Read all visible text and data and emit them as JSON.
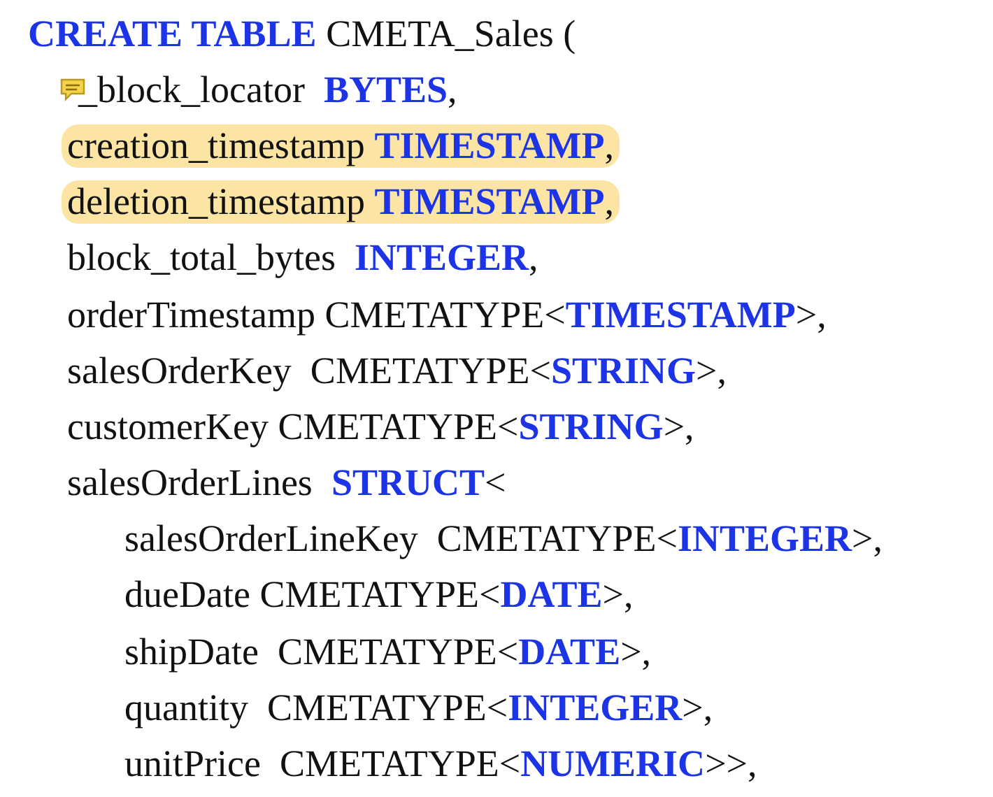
{
  "lines": [
    {
      "text": "**CREATE TABLE** CMETA_Sales (",
      "highlighted": false,
      "comment": false
    },
    {
      "text": "_block_locator  **BYTES**,",
      "highlighted": false,
      "comment": true
    },
    {
      "text": "creation_timestamp **TIMESTAMP**,",
      "highlighted": true,
      "comment": false
    },
    {
      "text": "deletion_timestamp **TIMESTAMP**,",
      "highlighted": true,
      "comment": false
    },
    {
      "text": "block_total_bytes  **INTEGER**,",
      "highlighted": false,
      "comment": false
    },
    {
      "text": "orderTimestamp CMETATYPE<**TIMESTAMP**>,",
      "highlighted": false,
      "comment": false
    },
    {
      "text": "salesOrderKey  CMETATYPE<**STRING**>,",
      "highlighted": false,
      "comment": false
    },
    {
      "text": "customerKey CMETATYPE<**STRING**>,",
      "highlighted": false,
      "comment": false
    },
    {
      "text": "salesOrderLines  **STRUCT**<",
      "highlighted": false,
      "comment": false,
      "children": [
        {
          "text": "salesOrderLineKey  CMETATYPE<**INTEGER**>,",
          "highlighted": false,
          "comment": false
        },
        {
          "text": "dueDate CMETATYPE<**DATE**>,",
          "highlighted": false,
          "comment": false
        },
        {
          "text": "shipDate  CMETATYPE<**DATE**>,",
          "highlighted": false,
          "comment": false
        },
        {
          "text": "quantity  CMETATYPE<**INTEGER**>,",
          "highlighted": false,
          "comment": false
        },
        {
          "text": "unitPrice  CMETATYPE<**NUMERIC**>>,",
          "highlighted": false,
          "comment": false
        }
      ]
    }
  ]
}
